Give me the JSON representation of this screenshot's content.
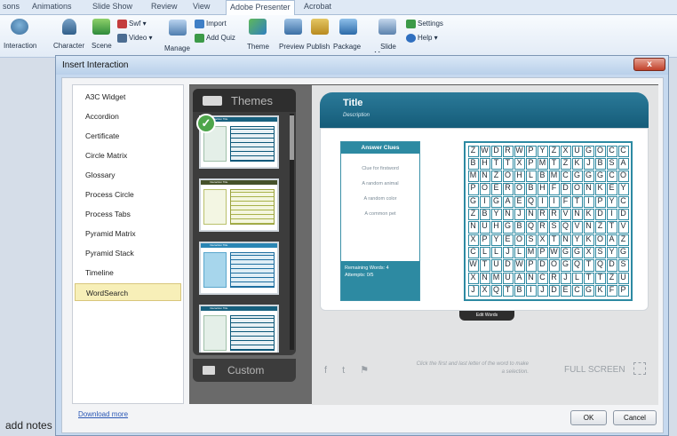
{
  "ribbon": {
    "tabs": [
      "sons",
      "Animations",
      "Slide Show",
      "Review",
      "View",
      "Adobe Presenter",
      "Acrobat"
    ],
    "active_tab": "Adobe Presenter",
    "buttons": {
      "interaction": "Interaction",
      "character": "Character",
      "scene": "Scene",
      "swf": "Swf",
      "video": "Video",
      "manage": "Manage",
      "import": "Import",
      "add_quiz": "Add Quiz",
      "theme": "Theme",
      "preview": "Preview",
      "publish": "Publish",
      "package": "Package",
      "slide_manager": "Slide Manager",
      "settings": "Settings",
      "help": "Help"
    }
  },
  "notes_placeholder": "add notes",
  "dialog": {
    "title": "Insert Interaction",
    "close_label": "x",
    "interactions": [
      "A3C Widget",
      "Accordion",
      "Certificate",
      "Circle Matrix",
      "Glossary",
      "Process Circle",
      "Process Tabs",
      "Pyramid Matrix",
      "Pyramid Stack",
      "Timeline",
      "WordSearch"
    ],
    "selected_interaction": "WordSearch",
    "download_more": "Download more",
    "ok_label": "OK",
    "cancel_label": "Cancel"
  },
  "themes": {
    "header": "Themes",
    "custom_label": "Custom",
    "thumb_title_1": "Interaction Title",
    "thumb_title_2": "Interaction Title",
    "thumb_title_3": "Interaction Title",
    "thumb_title_4": "Interaction Title"
  },
  "preview": {
    "title": "Title",
    "description": "Description",
    "clues_header": "Answer Clues",
    "clues": [
      "Clue for firstword",
      "A random animal",
      "A random color",
      "A common pet"
    ],
    "remaining": "Remaining Words: 4",
    "attempts": "Attempts: 0/5",
    "edit_words": "Edit Words",
    "hint": "Click the first and last letter of the word to make a selection.",
    "fullscreen": "FULL SCREEN",
    "grid": [
      [
        "Z",
        "W",
        "D",
        "R",
        "W",
        "P",
        "Y",
        "Z",
        "X",
        "U",
        "G",
        "O",
        "C",
        "C"
      ],
      [
        "B",
        "H",
        "T",
        "T",
        "X",
        "P",
        "M",
        "T",
        "Z",
        "K",
        "J",
        "B",
        "S",
        "A"
      ],
      [
        "M",
        "N",
        "Z",
        "O",
        "H",
        "L",
        "B",
        "M",
        "C",
        "G",
        "G",
        "G",
        "C",
        "O"
      ],
      [
        "P",
        "O",
        "E",
        "R",
        "O",
        "B",
        "H",
        "F",
        "D",
        "O",
        "N",
        "K",
        "E",
        "Y"
      ],
      [
        "G",
        "I",
        "G",
        "A",
        "E",
        "Q",
        "I",
        "I",
        "F",
        "T",
        "I",
        "P",
        "Y",
        "C"
      ],
      [
        "Z",
        "B",
        "Y",
        "N",
        "J",
        "N",
        "R",
        "R",
        "V",
        "N",
        "K",
        "D",
        "I",
        "D"
      ],
      [
        "N",
        "U",
        "H",
        "G",
        "B",
        "Q",
        "R",
        "S",
        "Q",
        "V",
        "N",
        "Z",
        "T",
        "V"
      ],
      [
        "X",
        "P",
        "Y",
        "E",
        "O",
        "S",
        "X",
        "T",
        "N",
        "Y",
        "K",
        "O",
        "A",
        "Z"
      ],
      [
        "C",
        "L",
        "L",
        "J",
        "L",
        "M",
        "P",
        "W",
        "G",
        "G",
        "X",
        "S",
        "Y",
        "G"
      ],
      [
        "W",
        "T",
        "U",
        "D",
        "W",
        "P",
        "D",
        "O",
        "G",
        "Q",
        "T",
        "Q",
        "D",
        "S"
      ],
      [
        "X",
        "N",
        "M",
        "U",
        "A",
        "N",
        "C",
        "R",
        "J",
        "L",
        "T",
        "T",
        "Z",
        "U"
      ],
      [
        "J",
        "X",
        "Q",
        "T",
        "B",
        "I",
        "J",
        "D",
        "E",
        "C",
        "G",
        "K",
        "F",
        "P"
      ]
    ]
  },
  "colors": {
    "accent": "#2d8aa2",
    "header": "#1a6585",
    "selected": "#f7efb8",
    "close": "#c1412a"
  }
}
